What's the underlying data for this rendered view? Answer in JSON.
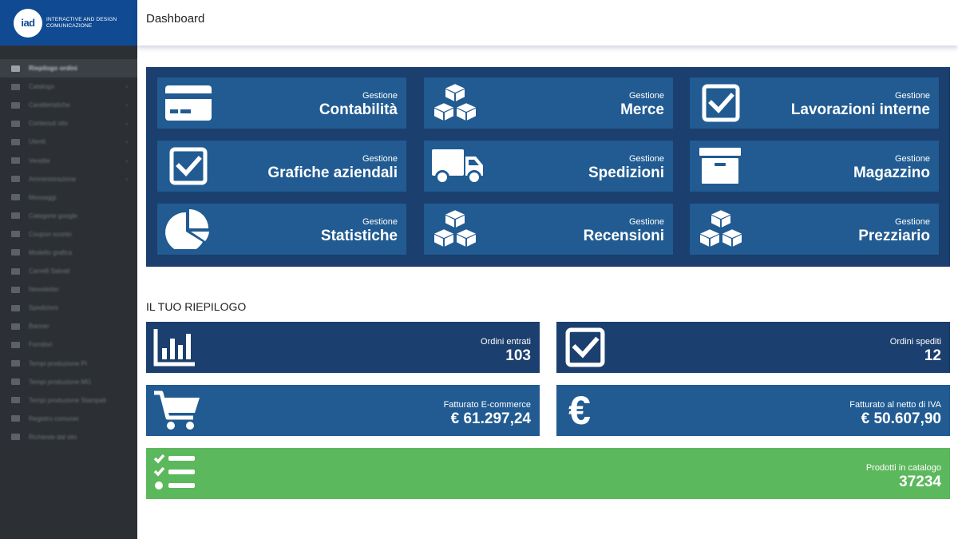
{
  "brand": {
    "logo_text": "iad",
    "line1": "INTERACTIVE AND DESIGN",
    "line2": "COMUNICAZIONE"
  },
  "sidebar": {
    "items": [
      {
        "label": "Riepilogo ordini",
        "arrow": ""
      },
      {
        "label": "Catalogo",
        "arrow": "›"
      },
      {
        "label": "Caratteristiche",
        "arrow": "›"
      },
      {
        "label": "Contenuti sito",
        "arrow": "›"
      },
      {
        "label": "Utenti",
        "arrow": "›"
      },
      {
        "label": "Vendite",
        "arrow": "›"
      },
      {
        "label": "Amministrazione",
        "arrow": "›"
      },
      {
        "label": "Messaggi",
        "arrow": ""
      },
      {
        "label": "Categorie google",
        "arrow": ""
      },
      {
        "label": "Coupon sconto",
        "arrow": ""
      },
      {
        "label": "Modello grafica",
        "arrow": ""
      },
      {
        "label": "Carrelli Salvati",
        "arrow": ""
      },
      {
        "label": "Newsletter",
        "arrow": ""
      },
      {
        "label": "Spedizioni",
        "arrow": ""
      },
      {
        "label": "Banner",
        "arrow": ""
      },
      {
        "label": "Fornitori",
        "arrow": ""
      },
      {
        "label": "Tempi produzione PI",
        "arrow": ""
      },
      {
        "label": "Tempi produzione MG",
        "arrow": ""
      },
      {
        "label": "Tempi produzione Stampati",
        "arrow": ""
      },
      {
        "label": "Registro comunei",
        "arrow": ""
      },
      {
        "label": "Richieste dal sito",
        "arrow": ""
      }
    ]
  },
  "header": {
    "title": "Dashboard"
  },
  "tiles": {
    "prefix": "Gestione",
    "contabilita": "Contabilità",
    "merce": "Merce",
    "lavorazioni": "Lavorazioni interne",
    "grafiche": "Grafiche aziendali",
    "spedizioni": "Spedizioni",
    "magazzino": "Magazzino",
    "statistiche": "Statistiche",
    "recensioni": "Recensioni",
    "prezziario": "Prezziario"
  },
  "summary": {
    "title": "IL TUO RIEPILOGO",
    "ordini_entrati": {
      "label": "Ordini entrati",
      "value": "103"
    },
    "ordini_spediti": {
      "label": "Ordini spediti",
      "value": "12"
    },
    "fatturato_ecommerce": {
      "label": "Fatturato E-commerce",
      "value": "€ 61.297,24"
    },
    "fatturato_netto": {
      "label": "Fatturato al netto di IVA",
      "value": "€ 50.607,90"
    },
    "prodotti": {
      "label": "Prodotti in catalogo",
      "value": "37234"
    }
  },
  "colors": {
    "brand": "#0f4a92",
    "panel": "#1b3f6e",
    "tile": "#215b92",
    "green": "#5cb85c",
    "sidebar": "#2c3034"
  },
  "icons": {
    "contabilita": "credit-card-icon",
    "merce": "cubes-icon",
    "lavorazioni": "check-square-icon",
    "grafiche": "check-square-icon",
    "spedizioni": "truck-icon",
    "magazzino": "archive-box-icon",
    "statistiche": "pie-chart-icon",
    "recensioni": "cubes-icon",
    "prezziario": "cubes-icon",
    "ordini_entrati": "bar-chart-icon",
    "ordini_spediti": "check-square-icon",
    "fatturato_ecommerce": "shopping-cart-icon",
    "fatturato_netto": "euro-icon",
    "prodotti": "checklist-icon"
  }
}
